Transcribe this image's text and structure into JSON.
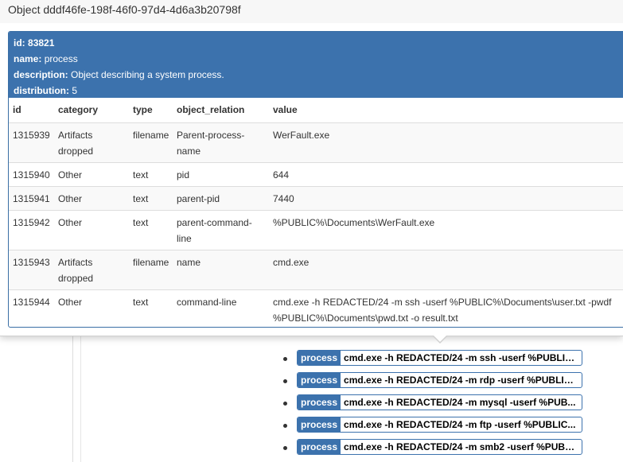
{
  "popover": {
    "title": "Object dddf46fe-198f-46f0-97d4-4d6a3b20798f",
    "object": {
      "id_label": "id:",
      "id_value": "83821",
      "name_label": "name:",
      "name_value": "process",
      "description_label": "description:",
      "description_value": "Object describing a system process.",
      "distribution_label": "distribution:",
      "distribution_value": "5"
    },
    "table": {
      "headers": [
        "id",
        "category",
        "type",
        "object_relation",
        "value"
      ],
      "rows": [
        {
          "id": "1315939",
          "category": "Artifacts dropped",
          "type": "filename",
          "relation": "Parent-process-name",
          "value": "WerFault.exe"
        },
        {
          "id": "1315940",
          "category": "Other",
          "type": "text",
          "relation": "pid",
          "value": "644"
        },
        {
          "id": "1315941",
          "category": "Other",
          "type": "text",
          "relation": "parent-pid",
          "value": "7440"
        },
        {
          "id": "1315942",
          "category": "Other",
          "type": "text",
          "relation": "parent-command-line",
          "value": "%PUBLIC%\\Documents\\WerFault.exe"
        },
        {
          "id": "1315943",
          "category": "Artifacts dropped",
          "type": "filename",
          "relation": "name",
          "value": "cmd.exe"
        },
        {
          "id": "1315944",
          "category": "Other",
          "type": "text",
          "relation": "command-line",
          "value": "cmd.exe -h REDACTED/24 -m ssh -userf %PUBLIC%\\Documents\\user.txt -pwdf %PUBLIC%\\Documents\\pwd.txt -o result.txt"
        }
      ]
    }
  },
  "process_list": [
    {
      "name": "process",
      "value": "cmd.exe -h REDACTED/24 -m ssh -userf %PUBLIC..."
    },
    {
      "name": "process",
      "value": "cmd.exe -h REDACTED/24 -m rdp -userf %PUBLIC..."
    },
    {
      "name": "process",
      "value": "cmd.exe -h REDACTED/24 -m mysql -userf %PUB..."
    },
    {
      "name": "process",
      "value": "cmd.exe -h REDACTED/24 -m ftp -userf %PUBLIC..."
    },
    {
      "name": "process",
      "value": "cmd.exe -h REDACTED/24 -m smb2 -userf %PUBL..."
    }
  ],
  "colors": {
    "accent": "#3c72ad"
  }
}
